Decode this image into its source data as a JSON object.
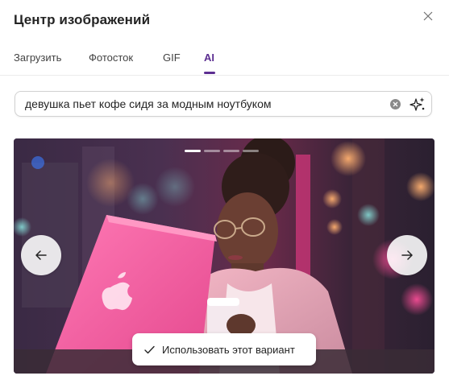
{
  "dialog": {
    "title": "Центр изображений",
    "close_icon": "close-icon"
  },
  "tabs": [
    {
      "label": "Загрузить",
      "active": false
    },
    {
      "label": "Фотосток",
      "active": false
    },
    {
      "label": "GIF",
      "active": false
    },
    {
      "label": "AI",
      "active": true
    }
  ],
  "search": {
    "value": "девушка пьет кофе сидя за модным ноутбуком",
    "clear_icon": "clear-icon",
    "generate_icon": "sparkle-icon"
  },
  "carousel": {
    "slide_count": 4,
    "current_slide": 1,
    "prev_icon": "arrow-left-icon",
    "next_icon": "arrow-right-icon",
    "use_button_label": "Использовать этот вариант",
    "use_button_icon": "checkmark-icon"
  },
  "colors": {
    "accent": "#5c2e91",
    "text": "#242424"
  }
}
